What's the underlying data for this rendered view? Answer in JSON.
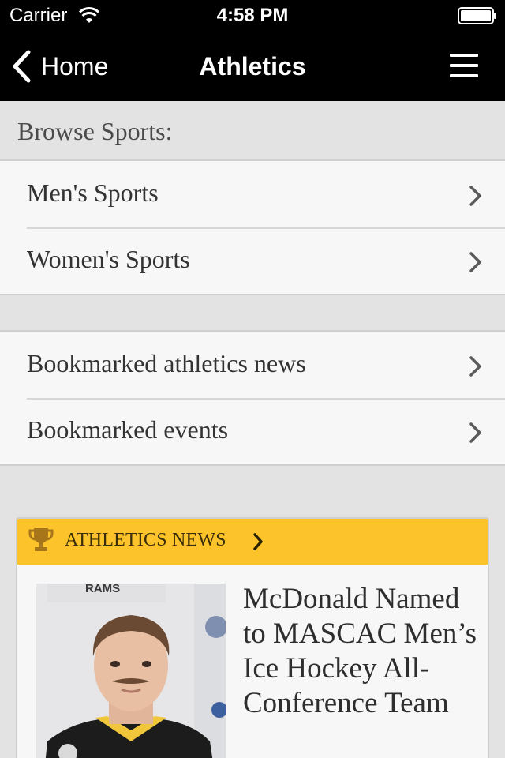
{
  "status_bar": {
    "carrier": "Carrier",
    "time": "4:58 PM",
    "wifi_icon": "wifi-icon",
    "battery_icon": "battery-icon"
  },
  "nav": {
    "back_label": "Home",
    "title": "Athletics",
    "back_icon": "chevron-left-icon",
    "menu_icon": "hamburger-menu-icon"
  },
  "browse": {
    "header": "Browse Sports:",
    "items": [
      {
        "label": "Men's Sports"
      },
      {
        "label": "Women's Sports"
      }
    ]
  },
  "bookmarks": {
    "items": [
      {
        "label": "Bookmarked athletics news"
      },
      {
        "label": "Bookmarked events"
      }
    ]
  },
  "news_card": {
    "title": "ATHLETICS NEWS",
    "icon": "trophy-icon",
    "accent_color": "#fcc42a",
    "headline": "McDonald Named to MASCAC Men’s Ice Hockey All-Conference Team",
    "photo_text": "RAMS"
  }
}
